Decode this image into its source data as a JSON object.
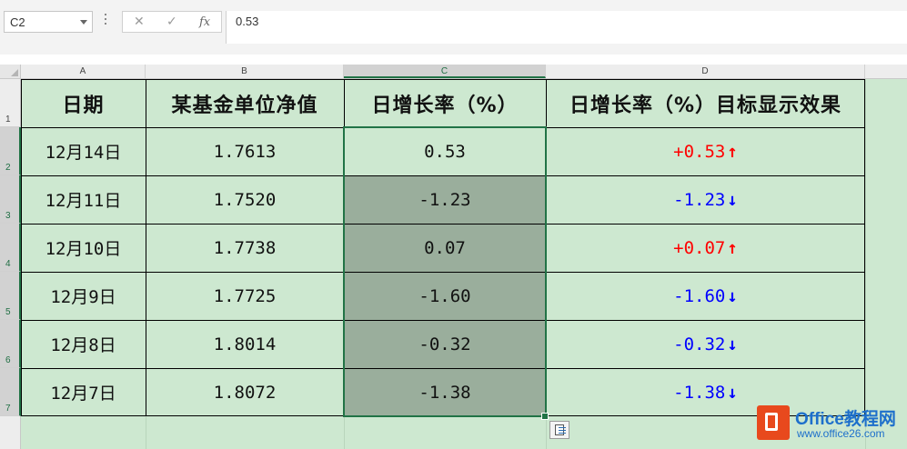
{
  "formula_bar": {
    "name_box": "C2",
    "formula_value": "0.53"
  },
  "columns": [
    "A",
    "B",
    "C",
    "D"
  ],
  "rows": [
    "1",
    "2",
    "3",
    "4",
    "5",
    "6",
    "7"
  ],
  "table": {
    "headers": [
      "日期",
      "某基金单位净值",
      "日增长率（%）",
      "日增长率（%）目标显示效果"
    ],
    "rows": [
      {
        "date": "12月14日",
        "nav": "1.7613",
        "rate": "0.53",
        "display": "+0.53",
        "dir": "up"
      },
      {
        "date": "12月11日",
        "nav": "1.7520",
        "rate": "-1.23",
        "display": "-1.23",
        "dir": "down"
      },
      {
        "date": "12月10日",
        "nav": "1.7738",
        "rate": "0.07",
        "display": "+0.07",
        "dir": "up"
      },
      {
        "date": "12月9日",
        "nav": "1.7725",
        "rate": "-1.60",
        "display": "-1.60",
        "dir": "down"
      },
      {
        "date": "12月8日",
        "nav": "1.8014",
        "rate": "-0.32",
        "display": "-0.32",
        "dir": "down"
      },
      {
        "date": "12月7日",
        "nav": "1.8072",
        "rate": "-1.38",
        "display": "-1.38",
        "dir": "down"
      }
    ]
  },
  "glyphs": {
    "up": "↑",
    "down": "↓"
  },
  "colors": {
    "positive": "#ff0000",
    "negative": "#0000ff",
    "cell_fill": "#cde8d0",
    "selected_fill": "#9aae9c",
    "selection_border": "#217346"
  },
  "watermark": {
    "brand": "Office教程网",
    "url": "www.office26.com"
  }
}
